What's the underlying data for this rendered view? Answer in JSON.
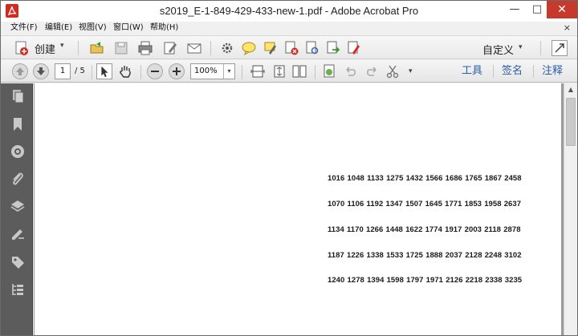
{
  "window": {
    "title": "s2019_E-1-849-429-433-new-1.pdf - Adobe Acrobat Pro",
    "min_glyph": "—",
    "max_glyph": "□",
    "close_glyph": "✕"
  },
  "menubar": {
    "items": [
      "文件(F)",
      "编辑(E)",
      "视图(V)",
      "窗口(W)",
      "帮助(H)"
    ],
    "close_glyph": "×"
  },
  "toolbar": {
    "create_label": "创建",
    "customize_label": "自定义",
    "caret": "▾"
  },
  "navigation": {
    "current_page": "1",
    "total_pages": "/ 5",
    "zoom": "100%",
    "zoom_caret": "▾"
  },
  "panels": {
    "tools": "工具",
    "sign": "签名",
    "comment": "注释"
  },
  "document": {
    "rows": [
      [
        "1016",
        "1048",
        "1133",
        "1275",
        "1432",
        "1566",
        "1686",
        "1765",
        "1867",
        "2458"
      ],
      [
        "1070",
        "1106",
        "1192",
        "1347",
        "1507",
        "1645",
        "1771",
        "1853",
        "1958",
        "2637"
      ],
      [
        "1134",
        "1170",
        "1266",
        "1448",
        "1622",
        "1774",
        "1917",
        "2003",
        "2118",
        "2878"
      ],
      [
        "1187",
        "1226",
        "1338",
        "1533",
        "1725",
        "1888",
        "2037",
        "2128",
        "2248",
        "3102"
      ],
      [
        "1240",
        "1278",
        "1394",
        "1598",
        "1797",
        "1971",
        "2126",
        "2218",
        "2338",
        "3235"
      ]
    ]
  },
  "colors": {
    "accent_red": "#d42a1e",
    "panel_link_blue": "#2b5ea7",
    "nav_bg": "#5c5c5c"
  }
}
